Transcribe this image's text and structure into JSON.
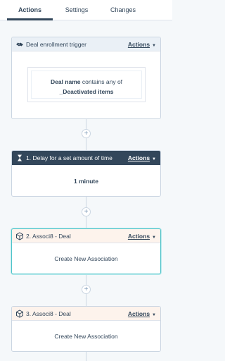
{
  "tabs": [
    {
      "label": "Actions",
      "active": true
    },
    {
      "label": "Settings",
      "active": false
    },
    {
      "label": "Changes",
      "active": false
    }
  ],
  "trigger": {
    "icon": "handshake-icon",
    "title": "Deal enrollment trigger",
    "actions_label": "Actions",
    "filter": {
      "property": "Deal name",
      "operator": "contains any of",
      "value": "_Deactivated items"
    }
  },
  "add_step_symbol": "+",
  "steps": [
    {
      "icon": "hourglass-icon",
      "title": "1. Delay for a set amount of time",
      "actions_label": "Actions",
      "body": "1 minute"
    },
    {
      "icon": "cube-icon",
      "title": "2. Associ8 - Deal",
      "actions_label": "Actions",
      "body": "Create New Association"
    },
    {
      "icon": "cube-icon",
      "title": "3. Associ8 - Deal",
      "actions_label": "Actions",
      "body": "Create New Association"
    }
  ],
  "colors": {
    "accent_selected": "#4fc3c9",
    "delay_header": "#33475b",
    "trigger_header": "#eaf0f6",
    "assoc_header": "#fdf3ec"
  }
}
